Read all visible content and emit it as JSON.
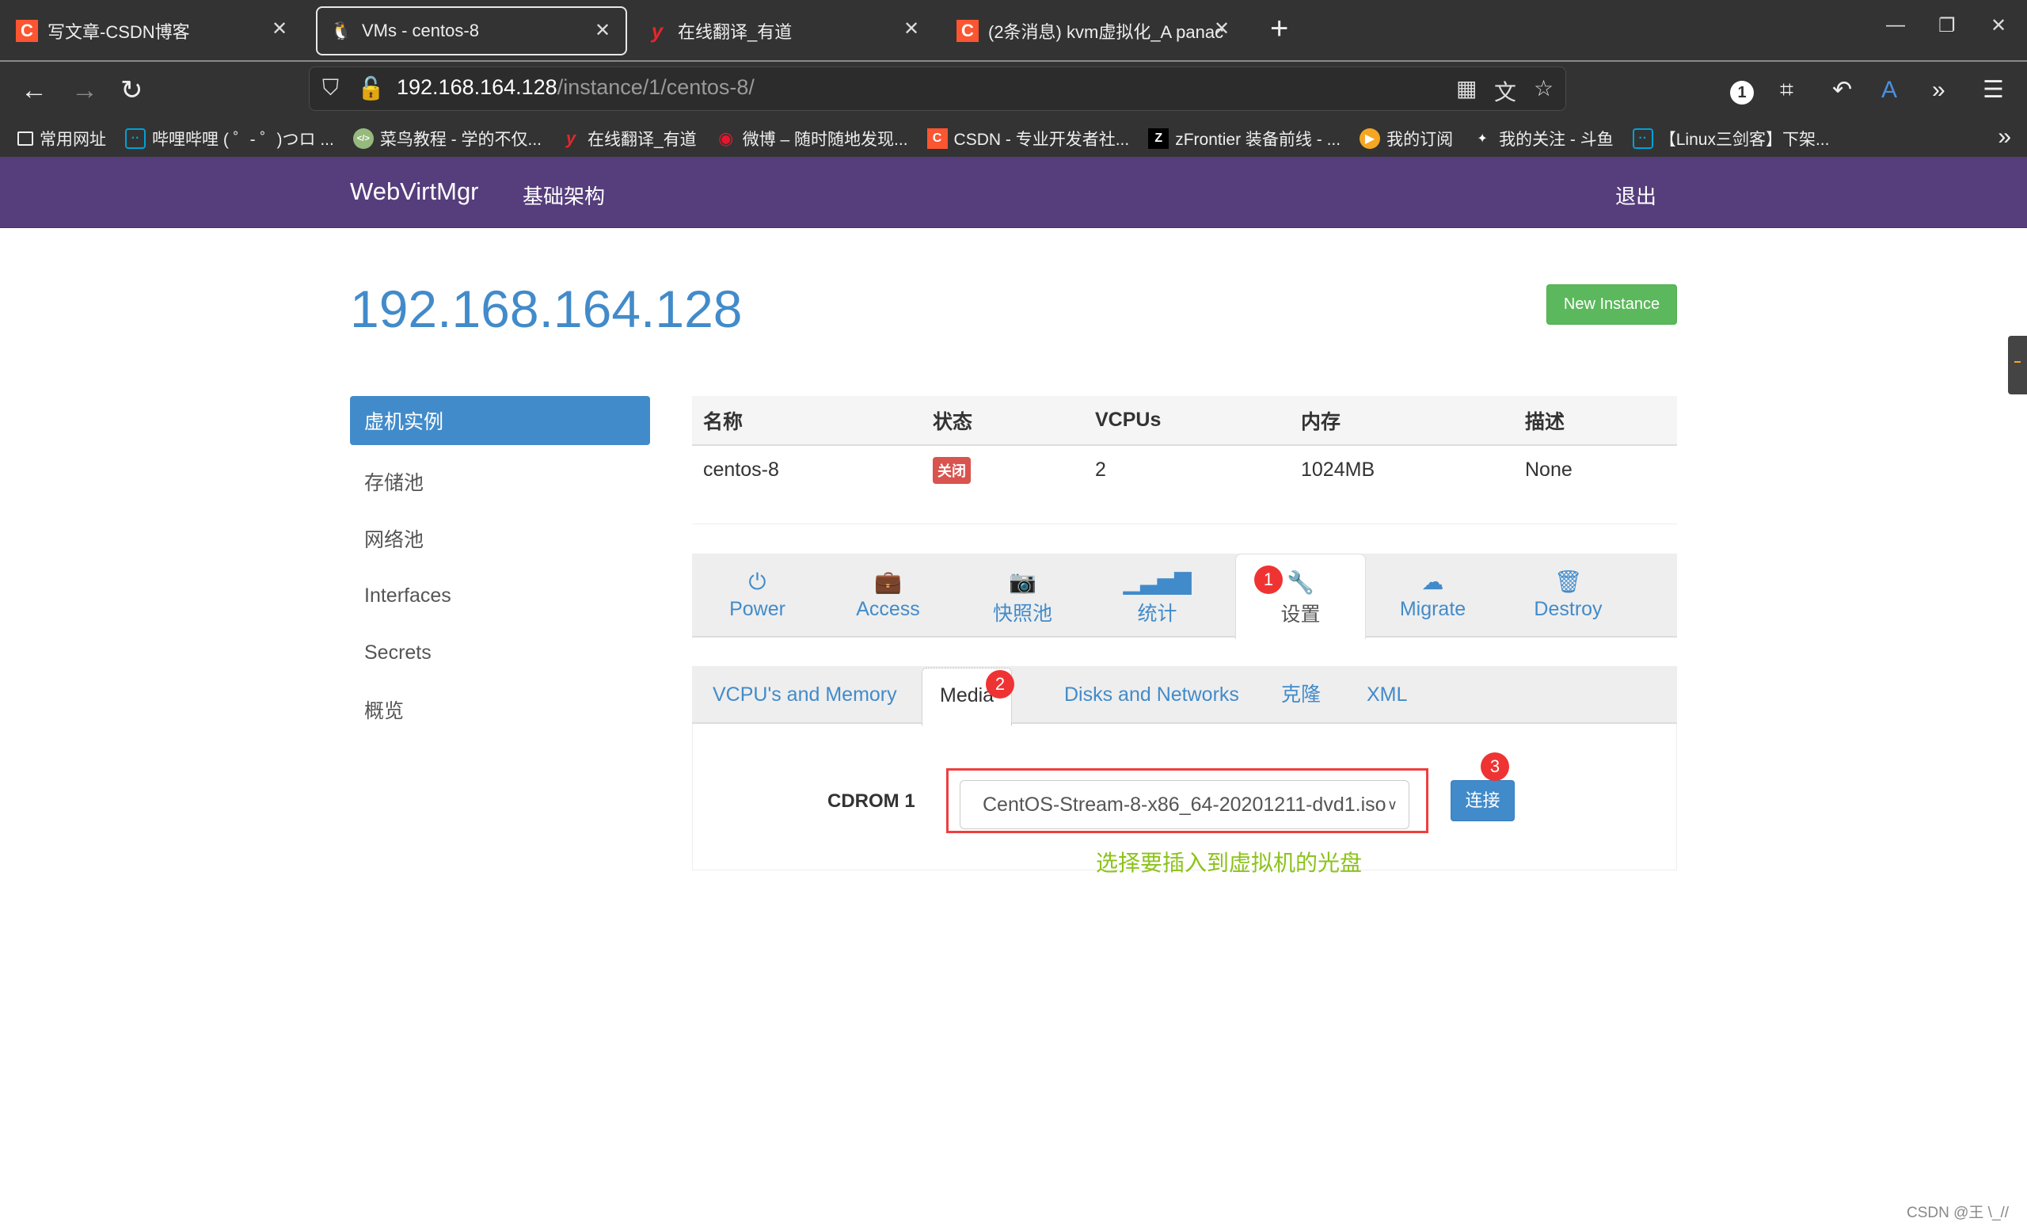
{
  "browser": {
    "tabs": [
      {
        "title": "写文章-CSDN博客",
        "favicon": "csdn-icon",
        "active": false
      },
      {
        "title": "VMs - centos-8",
        "favicon": "tux-icon",
        "active": true
      },
      {
        "title": "在线翻译_有道",
        "favicon": "youdao-icon",
        "active": false
      },
      {
        "title": "(2条消息) kvm虚拟化_A panac",
        "favicon": "csdn-icon",
        "active": false
      }
    ],
    "url_host": "192.168.164.128",
    "url_path": "/instance/1/centos-8/",
    "extension_badge": "1",
    "bookmarks": [
      {
        "label": "常用网址",
        "icon": "folder-icon"
      },
      {
        "label": "哔哩哔哩 ( ゜- ゜)つロ ...",
        "icon": "bilibili-icon"
      },
      {
        "label": "菜鸟教程 - 学的不仅...",
        "icon": "runoob-icon"
      },
      {
        "label": "在线翻译_有道",
        "icon": "youdao-icon"
      },
      {
        "label": "微博 – 随时随地发现...",
        "icon": "weibo-icon"
      },
      {
        "label": "CSDN - 专业开发者社...",
        "icon": "csdn-icon"
      },
      {
        "label": "zFrontier 装备前线 - ...",
        "icon": "zfrontier-icon"
      },
      {
        "label": "我的订阅",
        "icon": "subscription-icon"
      },
      {
        "label": "我的关注 - 斗鱼",
        "icon": "douyu-icon"
      },
      {
        "label": "【Linux三剑客】下架...",
        "icon": "bilibili-icon"
      }
    ]
  },
  "navbar": {
    "brand": "WebVirtMgr",
    "infra": "基础架构",
    "logout": "退出"
  },
  "page": {
    "title": "192.168.164.128",
    "new_instance": "New Instance"
  },
  "sidebar": {
    "items": [
      {
        "label": "虚机实例",
        "active": true
      },
      {
        "label": "存储池",
        "active": false
      },
      {
        "label": "网络池",
        "active": false
      },
      {
        "label": "Interfaces",
        "active": false
      },
      {
        "label": "Secrets",
        "active": false
      },
      {
        "label": "概览",
        "active": false
      }
    ]
  },
  "vm_table": {
    "headers": [
      "名称",
      "状态",
      "VCPUs",
      "内存",
      "描述"
    ],
    "rows": [
      {
        "name": "centos-8",
        "status": "关闭",
        "vcpus": "2",
        "memory": "1024MB",
        "description": "None"
      }
    ]
  },
  "action_tabs": [
    {
      "label": "Power",
      "icon": "power-icon"
    },
    {
      "label": "Access",
      "icon": "briefcase-icon"
    },
    {
      "label": "快照池",
      "icon": "camera-icon"
    },
    {
      "label": "统计",
      "icon": "signal-icon"
    },
    {
      "label": "设置",
      "icon": "wrench-icon",
      "active": true
    },
    {
      "label": "Migrate",
      "icon": "cloud-download-icon"
    },
    {
      "label": "Destroy",
      "icon": "trash-icon"
    }
  ],
  "sub_tabs": [
    {
      "label": "VCPU's and Memory"
    },
    {
      "label": "Media",
      "active": true
    },
    {
      "label": "Disks and Networks"
    },
    {
      "label": "克隆"
    },
    {
      "label": "XML"
    }
  ],
  "media": {
    "cdrom_label": "CDROM 1",
    "selected_iso": "CentOS-Stream-8-x86_64-20201211-dvd1.iso",
    "connect_label": "连接"
  },
  "annotations": {
    "step1": "1",
    "step2": "2",
    "step3": "3",
    "note": "选择要插入到虚拟机的光盘"
  },
  "watermark": "CSDN @王 \\_//"
}
